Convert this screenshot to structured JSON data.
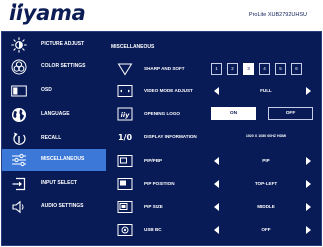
{
  "brand": {
    "logo": "iiyama",
    "model": "ProLite XUB2792UHSU"
  },
  "sidebar": {
    "items": [
      {
        "label": "PICTURE ADJUST",
        "icon": "picture-adjust-icon"
      },
      {
        "label": "COLOR SETTINGS",
        "icon": "color-settings-icon"
      },
      {
        "label": "OSD",
        "icon": "osd-icon"
      },
      {
        "label": "LANGUAGE",
        "icon": "globe-icon"
      },
      {
        "label": "RECALL",
        "icon": "recall-icon"
      },
      {
        "label": "MISCELLANEOUS",
        "icon": "miscellaneous-icon",
        "active": true
      },
      {
        "label": "INPUT SELECT",
        "icon": "input-select-icon"
      },
      {
        "label": "AUDIO SETTINGS",
        "icon": "speaker-icon"
      }
    ]
  },
  "content": {
    "title": "MISCELLANEOUS",
    "sharpness": {
      "label": "SHARP AND SOFT",
      "options": [
        "1",
        "2",
        "3",
        "4",
        "5",
        "6"
      ],
      "selected": "3"
    },
    "video_mode": {
      "label": "VIDEO MODE ADJUST",
      "value": "FULL"
    },
    "opening_logo": {
      "label": "OPENING LOGO",
      "on": "ON",
      "off": "OFF",
      "selected": "ON"
    },
    "display_info": {
      "label": "DISPLAY INFORMATION",
      "value": "1920 X 1080 60HZ HDMI"
    },
    "pip_pbp": {
      "label": "PIP/PBP",
      "value": "PIP"
    },
    "pip_position": {
      "label": "PIP POSITION",
      "value": "TOP-LEFT"
    },
    "pip_size": {
      "label": "PIP SIZE",
      "value": "MIDDLE"
    },
    "usb_bc": {
      "label": "USB BC",
      "value": "OFF"
    }
  },
  "colors": {
    "background": "#081b57",
    "highlight": "#3c78d8",
    "text": "#ffffff",
    "brand": "#0d1e57"
  }
}
